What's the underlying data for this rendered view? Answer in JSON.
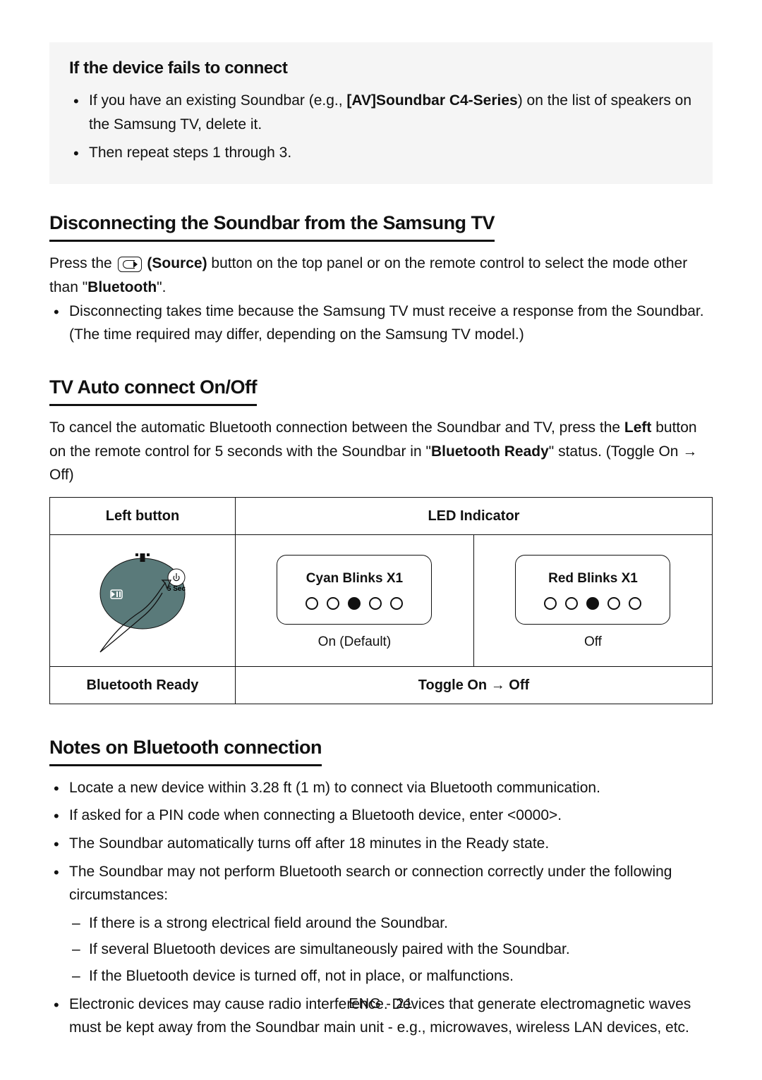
{
  "graybox": {
    "heading": "If the device fails to connect",
    "item1_before": "If you have an existing Soundbar (e.g., ",
    "item1_bold": "[AV]Soundbar C4-Series",
    "item1_after": ") on the list of speakers on the Samsung TV, delete it.",
    "item2": "Then repeat steps 1 through 3."
  },
  "disconnect": {
    "heading": "Disconnecting the Soundbar from the Samsung TV",
    "p1_before": "Press the ",
    "p1_source": "(Source)",
    "p1_after": " button on the top panel or on the remote control to select the mode other than \"",
    "p1_bold2": "Bluetooth",
    "p1_after2": "\".",
    "bullet": "Disconnecting takes time because the Samsung TV must receive a response from the Soundbar. (The time required may differ, depending on the Samsung TV model.)"
  },
  "autoconnect": {
    "heading": "TV Auto connect On/Off",
    "p_before": "To cancel the automatic Bluetooth connection between the Soundbar and TV, press the ",
    "p_bold1": "Left",
    "p_mid": " button on the remote control for 5 seconds with the Soundbar in \"",
    "p_bold2": "Bluetooth Ready",
    "p_after": "\" status. (Toggle On → Off)"
  },
  "table": {
    "h1": "Left button",
    "h2": "LED Indicator",
    "sec_label": "5 Sec",
    "ind1_label": "Cyan Blinks X1",
    "ind1_sub": "On (Default)",
    "ind2_label": "Red Blinks X1",
    "ind2_sub": "Off",
    "r2c1": "Bluetooth Ready",
    "r2c2": "Toggle On → Off"
  },
  "notes": {
    "heading": "Notes on Bluetooth connection",
    "n1": "Locate a new device within 3.28 ft (1 m) to connect via Bluetooth communication.",
    "n2": "If asked for a PIN code when connecting a Bluetooth device, enter <0000>.",
    "n3": "The Soundbar automatically turns off after 18 minutes in the Ready state.",
    "n4": "The Soundbar may not perform Bluetooth search or connection correctly under the following circumstances:",
    "n4a": "If there is a strong electrical field around the Soundbar.",
    "n4b": "If several Bluetooth devices are simultaneously paired with the Soundbar.",
    "n4c": "If the Bluetooth device is turned off, not in place, or malfunctions.",
    "n5": "Electronic devices may cause radio interference. Devices that generate electromagnetic waves must be kept away from the Soundbar main unit - e.g., microwaves, wireless LAN devices, etc."
  },
  "footer": "ENG - 21"
}
